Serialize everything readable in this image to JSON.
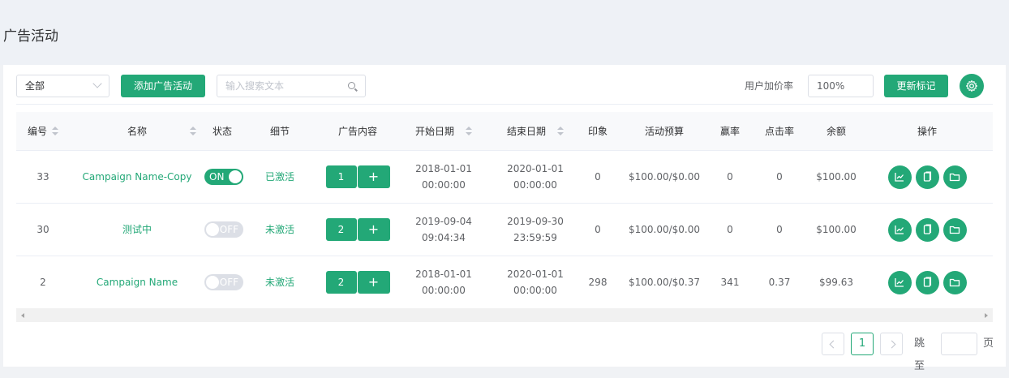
{
  "page": {
    "title": "广告活动"
  },
  "toolbar": {
    "filter_value": "全部",
    "add_button": "添加广告活动",
    "search_placeholder": "输入搜索文本",
    "bid_label": "用户加价率",
    "bid_value": "100%",
    "update_button": "更新标记"
  },
  "columns": {
    "id": "编号",
    "name": "名称",
    "state": "状态",
    "detail": "细节",
    "ad_content": "广告内容",
    "start_date": "开始日期",
    "end_date": "结束日期",
    "impressions": "印象",
    "budget": "活动预算",
    "win_rate": "赢率",
    "ctr": "点击率",
    "balance": "余额",
    "actions": "操作"
  },
  "rows": [
    {
      "id": "33",
      "name": "Campaign Name-Copy",
      "toggle": "ON",
      "toggle_on": true,
      "detail": "已激活",
      "content_count": "1",
      "content_add": "+",
      "start_date": "2018-01-01",
      "start_time": "00:00:00",
      "end_date": "2020-01-01",
      "end_time": "00:00:00",
      "impressions": "0",
      "budget": "$100.00/$0.00",
      "win_rate": "0",
      "ctr": "0",
      "balance": "$100.00"
    },
    {
      "id": "30",
      "name": "测试中",
      "toggle": "OFF",
      "toggle_on": false,
      "detail": "未激活",
      "content_count": "2",
      "content_add": "+",
      "start_date": "2019-09-04",
      "start_time": "09:04:34",
      "end_date": "2019-09-30",
      "end_time": "23:59:59",
      "impressions": "0",
      "budget": "$100.00/$0.00",
      "win_rate": "0",
      "ctr": "0",
      "balance": "$100.00"
    },
    {
      "id": "2",
      "name": "Campaign Name",
      "toggle": "OFF",
      "toggle_on": false,
      "detail": "未激活",
      "content_count": "2",
      "content_add": "+",
      "start_date": "2018-01-01",
      "start_time": "00:00:00",
      "end_date": "2020-01-01",
      "end_time": "00:00:00",
      "impressions": "298",
      "budget": "$100.00/$0.37",
      "win_rate": "341",
      "ctr": "0.37",
      "balance": "$99.63"
    }
  ],
  "pagination": {
    "current_page": "1",
    "goto_label": "跳至",
    "page_suffix": "页"
  },
  "colors": {
    "accent": "#23a877",
    "border": "#dcdfe6",
    "header_bg": "#eef1f6"
  },
  "icons": {
    "row_actions": [
      "chart-icon",
      "copy-icon",
      "folder-icon"
    ],
    "settings": "gear-icon",
    "search": "search-icon"
  }
}
